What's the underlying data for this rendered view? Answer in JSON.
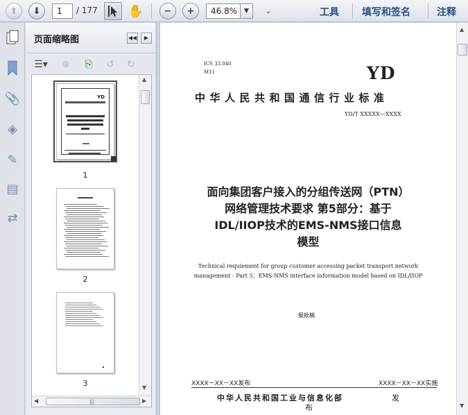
{
  "toolbar": {
    "page_current": "1",
    "page_total": "/ 177",
    "zoom": "46.8%",
    "menu_tools": "工具",
    "menu_sign": "填写和签名",
    "menu_comment": "注释"
  },
  "panel": {
    "title": "页面缩略图",
    "thumbnails": [
      {
        "label": "1"
      },
      {
        "label": "2"
      },
      {
        "label": "3"
      }
    ]
  },
  "document": {
    "ics": "ICS 33.040",
    "m_code": "M11",
    "logo": "YD",
    "standard_org": "中华人民共和国通信行业标准",
    "standard_no": "YD/T XXXXX—XXXX",
    "title_lines": [
      "面向集团客户接入的分组传送网（PTN）",
      "网络管理技术要求 第5部分：基于",
      "IDL/IIOP技术的EMS-NMS接口信息",
      "模型"
    ],
    "english_title_lines": [
      "Technical requiement for group customer accessing packet transport network",
      "management - Part 5：EMS-NMS interface information model based on IDL/IIOP"
    ],
    "draft": "报批稿",
    "publish_date": "XXXX－XX－XX发布",
    "implement_date": "XXXX－XX－XX实施",
    "issuer": "中华人民共和国工业与信息化部",
    "issuer_suffix": "发",
    "issuer_cont": "布"
  },
  "icons": {
    "nav": [
      "up-arrow-icon",
      "down-arrow-icon",
      "select-cursor-icon",
      "hand-icon",
      "zoom-out-icon",
      "zoom-in-icon"
    ],
    "rail": [
      "bookmark-icon",
      "attachment-icon",
      "layers-icon",
      "signature-icon",
      "page-icon",
      "compare-icon"
    ]
  },
  "colors": {
    "menu_blue": "#2c4f86",
    "toolbar_bg": "#e4e8ee",
    "rail_icon": "#7a8fae"
  }
}
